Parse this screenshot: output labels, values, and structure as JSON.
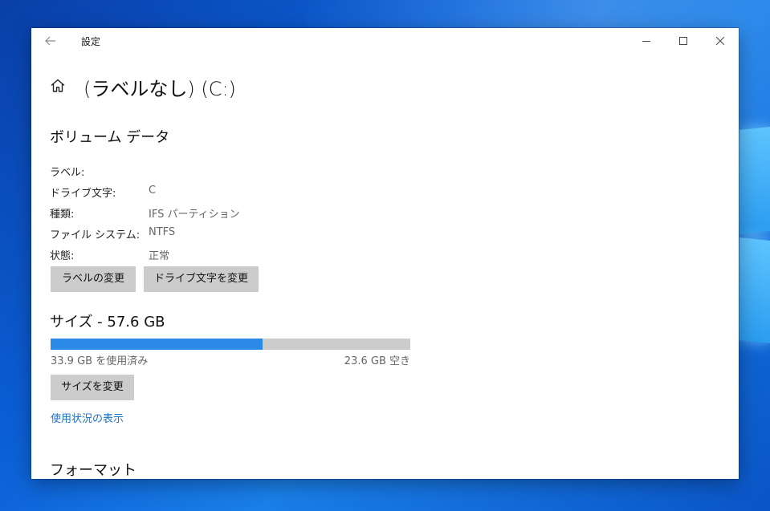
{
  "window": {
    "app_title": "設定",
    "accent_color": "#2b8ae8",
    "link_color": "#1a73c7"
  },
  "page": {
    "title": "(ラベルなし) (C:)"
  },
  "volume": {
    "heading": "ボリューム データ",
    "properties": [
      {
        "label": "ラベル:",
        "value": ""
      },
      {
        "label": "ドライブ文字:",
        "value": "C"
      },
      {
        "label": "種類:",
        "value": "IFS パーティション"
      },
      {
        "label": "ファイル システム:",
        "value": "NTFS"
      },
      {
        "label": "状態:",
        "value": "正常"
      }
    ],
    "change_label_button": "ラベルの変更",
    "change_drive_letter_button": "ドライブ文字を変更"
  },
  "size": {
    "heading": "サイズ - 57.6 GB",
    "used_text": "33.9 GB を使用済み",
    "free_text": "23.6 GB 空き",
    "used_fraction": 0.589,
    "resize_button": "サイズを変更",
    "usage_link": "使用状況の表示"
  },
  "format": {
    "heading": "フォーマット"
  },
  "icons": {
    "back": "back-arrow-icon",
    "home": "home-icon",
    "minimize": "minimize-icon",
    "maximize": "maximize-icon",
    "close": "close-icon"
  }
}
